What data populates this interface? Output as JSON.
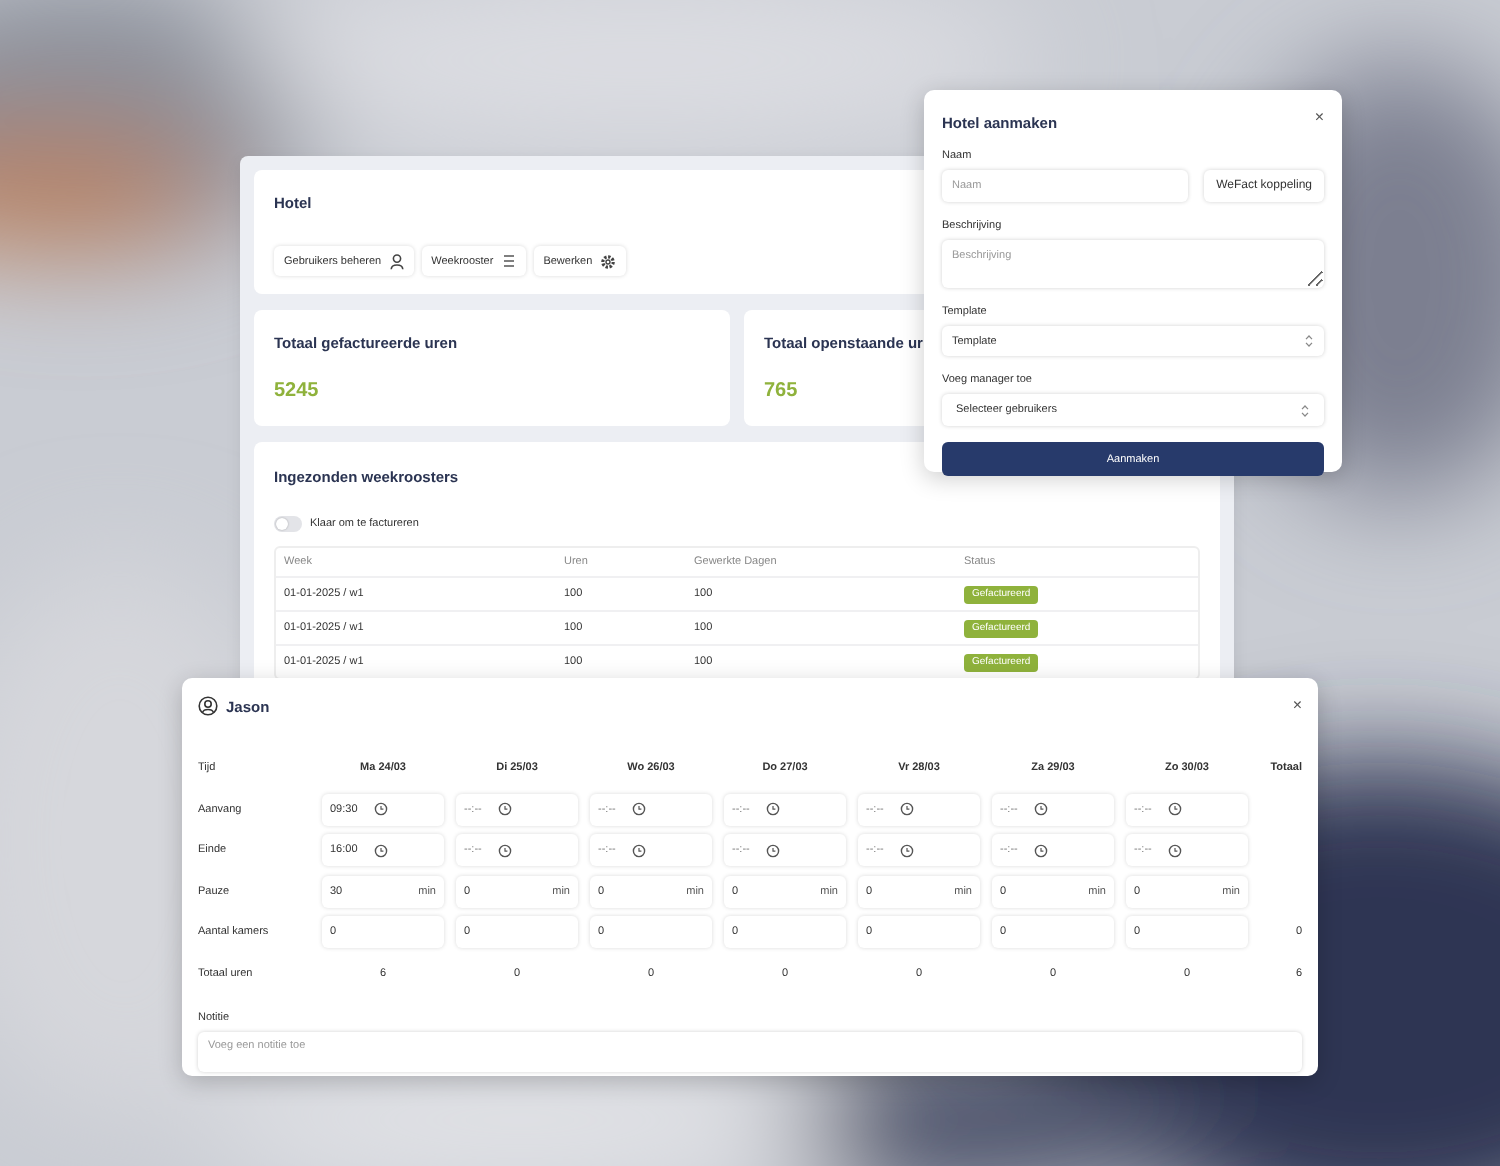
{
  "hotel_panel": {
    "title": "Hotel",
    "actions": [
      {
        "label": "Gebruikers beheren"
      },
      {
        "label": "Weekrooster"
      },
      {
        "label": "Bewerken"
      }
    ],
    "stats": [
      {
        "label": "Totaal gefactureerde uren",
        "value": "5245"
      },
      {
        "label": "Totaal openstaande ur",
        "value": "765"
      }
    ],
    "weekroosters": {
      "title": "Ingezonden weekroosters",
      "toggle": {
        "label": "Klaar om te factureren",
        "on": false
      },
      "columns": [
        "Week",
        "Uren",
        "Gewerkte Dagen",
        "Status"
      ],
      "rows": [
        {
          "week": "01-01-2025 / w1",
          "uren": "100",
          "dagen": "100",
          "status": "Gefactureerd"
        },
        {
          "week": "01-01-2025 / w1",
          "uren": "100",
          "dagen": "100",
          "status": "Gefactureerd"
        },
        {
          "week": "01-01-2025 / w1",
          "uren": "100",
          "dagen": "100",
          "status": "Gefactureerd"
        }
      ]
    }
  },
  "create_dialog": {
    "title": "Hotel aanmaken",
    "close": "×",
    "name_label": "Naam",
    "name_placeholder": "Naam",
    "link_button": "WeFact koppeling",
    "description_label": "Beschrijving",
    "description_placeholder": "Beschrijving",
    "template_label": "Template",
    "template_value": "Template",
    "manager_label": "Voeg manager toe",
    "manager_value": "Selecteer gebruikers",
    "submit": "Aanmaken"
  },
  "schedule_dialog": {
    "user": "Jason",
    "close": "×",
    "corner_label": "Tijd",
    "total_label": "Totaal",
    "row_labels": [
      "Aanvang",
      "Einde",
      "Pauze",
      "Aantal kamers",
      "Totaal uren"
    ],
    "days": [
      {
        "label": "Ma 24/03",
        "start": {
          "value": "09:30"
        },
        "end": {
          "value": "16:00"
        },
        "pause": "30",
        "pause_unit": "min",
        "rooms": "0",
        "hours": "6"
      },
      {
        "label": "Di 25/03",
        "start": {
          "placeholder": "--:--"
        },
        "end": {
          "placeholder": "--:--"
        },
        "pause": "0",
        "pause_unit": "min",
        "rooms": "0",
        "hours": "0"
      },
      {
        "label": "Wo 26/03",
        "start": {
          "placeholder": "--:--"
        },
        "end": {
          "placeholder": "--:--"
        },
        "pause": "0",
        "pause_unit": "min",
        "rooms": "0",
        "hours": "0"
      },
      {
        "label": "Do 27/03",
        "start": {
          "placeholder": "--:--"
        },
        "end": {
          "placeholder": "--:--"
        },
        "pause": "0",
        "pause_unit": "min",
        "rooms": "0",
        "hours": "0"
      },
      {
        "label": "Vr 28/03",
        "start": {
          "placeholder": "--:--"
        },
        "end": {
          "placeholder": "--:--"
        },
        "pause": "0",
        "pause_unit": "min",
        "rooms": "0",
        "hours": "0"
      },
      {
        "label": "Za 29/03",
        "start": {
          "placeholder": "--:--"
        },
        "end": {
          "placeholder": "--:--"
        },
        "pause": "0",
        "pause_unit": "min",
        "rooms": "0",
        "hours": "0"
      },
      {
        "label": "Zo 30/03",
        "start": {
          "placeholder": "--:--"
        },
        "end": {
          "placeholder": "--:--"
        },
        "pause": "0",
        "pause_unit": "min",
        "rooms": "0",
        "hours": "0"
      }
    ],
    "totals": {
      "rooms": "0",
      "hours": "6"
    },
    "note": {
      "label": "Notitie",
      "placeholder": "Voeg een notitie toe"
    }
  }
}
